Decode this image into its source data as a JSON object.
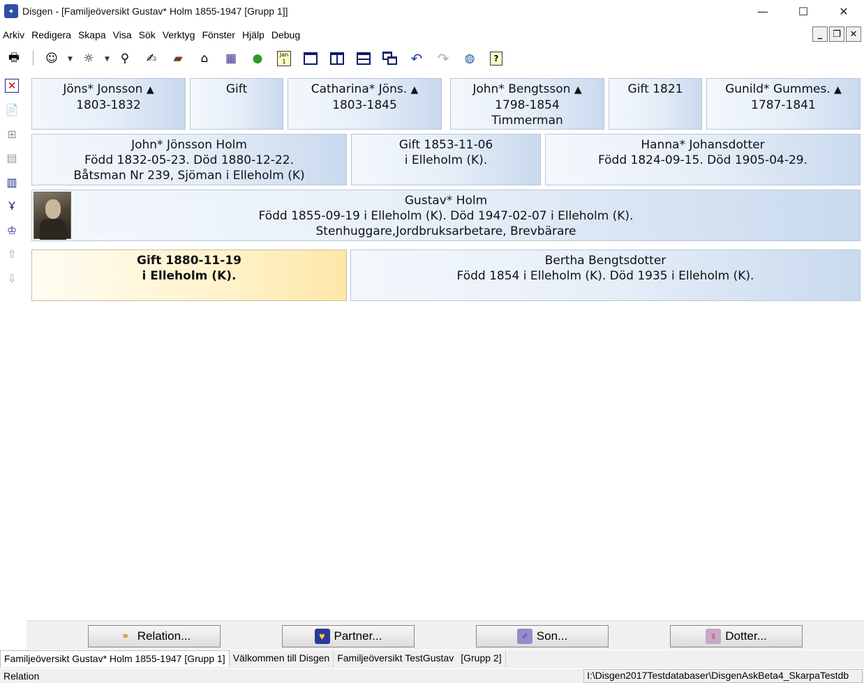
{
  "window": {
    "title": "Disgen - [Familjeöversikt Gustav* Holm 1855-1947 [Grupp 1]]",
    "app_icon": "disgen-app-icon",
    "minimize": "—",
    "maximize": "☐",
    "close": "✕"
  },
  "menu": {
    "items": [
      "Arkiv",
      "Redigera",
      "Skapa",
      "Visa",
      "Sök",
      "Verktyg",
      "Fönster",
      "Hjälp",
      "Debug"
    ],
    "mdi_minimize": "_",
    "mdi_restore": "❐",
    "mdi_close": "✕"
  },
  "toolbar": {
    "icons": [
      "print-icon",
      "person-icon",
      "person-search-icon",
      "binoculars-icon",
      "handshake-icon",
      "book-icon",
      "home-icon",
      "map-icon",
      "world-map-icon",
      "calendar-icon",
      "single-window-icon",
      "split-vertical-icon",
      "split-horizontal-icon",
      "cascade-icon",
      "undo-icon",
      "redo-icon",
      "globe-icon",
      "help-icon"
    ],
    "calendar_text": "Jan 1"
  },
  "lefttools": {
    "icons": [
      "delete-icon",
      "document-icon",
      "tree-icon",
      "grid-icon",
      "columns-icon",
      "pedigree-icon",
      "descendants-icon",
      "up-person-icon",
      "down-person-icon"
    ]
  },
  "grandparents": [
    {
      "name": "Jöns* Jonsson",
      "dates": "1803-1832",
      "arrow": "▲"
    },
    {
      "label": "Gift"
    },
    {
      "name": "Catharina* Jöns.",
      "dates": "1803-1845",
      "arrow": "▲"
    },
    {
      "name": "John* Bengtsson",
      "dates": "1798-1854",
      "occupation": "Timmerman",
      "arrow": "▲"
    },
    {
      "label": "Gift 1821"
    },
    {
      "name": "Gunild* Gummes.",
      "dates": "1787-1841",
      "arrow": "▲"
    }
  ],
  "parents": {
    "father": {
      "name": "John* Jönsson Holm",
      "life": "Född 1832-05-23. Död 1880-12-22.",
      "occupation": "Båtsman Nr 239, Sjöman  i Elleholm (K)"
    },
    "marriage": {
      "line1": "Gift 1853-11-06",
      "line2": "i  Elleholm (K)."
    },
    "mother": {
      "name": "Hanna* Johansdotter",
      "life": "Född 1824-09-15. Död 1905-04-29."
    }
  },
  "main_person": {
    "name": "Gustav* Holm",
    "life": "Född 1855-09-19 i Elleholm (K). Död 1947-02-07 i Elleholm (K).",
    "occupation": "Stenhuggare,Jordbruksarbetare, Brevbärare"
  },
  "marriage": {
    "line1": "Gift 1880-11-19",
    "line2": "i  Elleholm (K)."
  },
  "spouse": {
    "name": "Bertha Bengtsdotter",
    "life": "Född 1854 i Elleholm (K). Död 1935 i Elleholm (K)."
  },
  "actions": {
    "relation": "Relation...",
    "partner": "Partner...",
    "son": "Son...",
    "dotter": "Dotter..."
  },
  "tabs": [
    "Familjeöversikt Gustav* Holm 1855-1947 [Grupp 1]",
    "Välkommen till Disgen",
    "Familjeöversikt TestGustav",
    "[Grupp 2]"
  ],
  "status": {
    "left": "Relation",
    "right": "I:\\Disgen2017Testdatabaser\\DisgenAskBeta4_SkarpaTestdb"
  }
}
